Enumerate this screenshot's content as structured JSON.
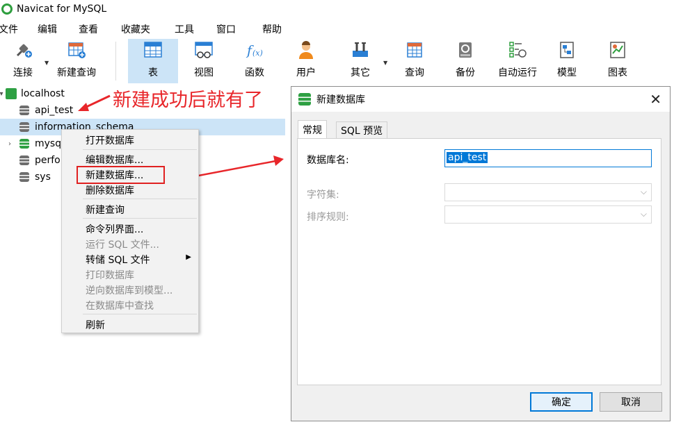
{
  "window": {
    "title": "Navicat for MySQL"
  },
  "menu": [
    "文件",
    "编辑",
    "查看",
    "收藏夹",
    "工具",
    "窗口",
    "帮助"
  ],
  "toolbar": [
    {
      "label": "连接",
      "icon": "plug-icon"
    },
    {
      "label": "新建查询",
      "icon": "new-query-icon"
    },
    {
      "label": "表",
      "icon": "table-icon"
    },
    {
      "label": "视图",
      "icon": "view-icon"
    },
    {
      "label": "函数",
      "icon": "function-icon"
    },
    {
      "label": "用户",
      "icon": "user-icon"
    },
    {
      "label": "其它",
      "icon": "tools-icon"
    },
    {
      "label": "查询",
      "icon": "query-icon"
    },
    {
      "label": "备份",
      "icon": "backup-icon"
    },
    {
      "label": "自动运行",
      "icon": "schedule-icon"
    },
    {
      "label": "模型",
      "icon": "model-icon"
    },
    {
      "label": "图表",
      "icon": "chart-icon"
    }
  ],
  "tree": {
    "connection": "localhost",
    "databases": [
      "api_test",
      "information_schema",
      "mysq",
      "perfo",
      "sys"
    ]
  },
  "annotation": "新建成功后就有了",
  "context_menu": {
    "items": [
      "打开数据库",
      "编辑数据库...",
      "新建数据库...",
      "删除数据库",
      "新建查询",
      "命令列界面...",
      "运行 SQL 文件...",
      "转储 SQL 文件",
      "打印数据库",
      "逆向数据库到模型...",
      "在数据库中查找",
      "刷新"
    ]
  },
  "dialog": {
    "title": "新建数据库",
    "tabs": [
      "常规",
      "SQL 预览"
    ],
    "db_name_label": "数据库名:",
    "db_name_value": "api_test",
    "charset_label": "字符集:",
    "collation_label": "排序规则:",
    "ok": "确定",
    "cancel": "取消"
  },
  "colors": {
    "accent": "#0078d7",
    "selection": "#cce4f7",
    "annotation_red": "#e8262a",
    "green": "#2ea043"
  }
}
